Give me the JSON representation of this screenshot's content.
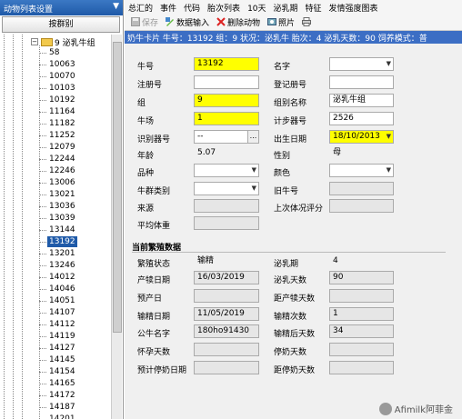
{
  "left_panel": {
    "title": "动物列表设置",
    "dropdown_arrow": "▼",
    "group_button": "按群别",
    "tree_root_label": "9 泌乳牛组",
    "tree_items": [
      "58",
      "10063",
      "10070",
      "10103",
      "10192",
      "11164",
      "11182",
      "11252",
      "12079",
      "12244",
      "12246",
      "13006",
      "13021",
      "13036",
      "13039",
      "13144",
      "13192",
      "13201",
      "13246",
      "14012",
      "14046",
      "14051",
      "14107",
      "14112",
      "14119",
      "14127",
      "14145",
      "14154",
      "14165",
      "14172",
      "14187",
      "14201"
    ],
    "selected_item": "13192"
  },
  "menu": [
    "总汇的",
    "事件",
    "代码",
    "胎次列表",
    "10天",
    "泌乳期",
    "特征",
    "发情强度图表"
  ],
  "toolbar": {
    "save_label": "保存",
    "data_input_label": "数据输入",
    "delete_animal_label": "删除动物",
    "photo_label": "照片"
  },
  "infobar_text": "奶牛卡片   牛号：13192   组：9   状况：泌乳牛   胎次：4   泌乳天数：90   饲养模式：普",
  "form": {
    "cow_no_label": "牛号",
    "cow_no": "13192",
    "name_label": "名字",
    "name": "",
    "reg_no_label": "注册号",
    "reg_no": "",
    "reg_cow_no_label": "登记册号",
    "reg_cow_no": "",
    "group_label": "组",
    "group": "9",
    "group_name_label": "组别名称",
    "group_name": "泌乳牛组",
    "farm_label": "牛场",
    "farm": "1",
    "pedometer_label": "计步器号",
    "pedometer": "2526",
    "id_device_label": "识别器号",
    "id_device": "--",
    "birth_date_label": "出生日期",
    "birth_date": "18/10/2013",
    "age_label": "年龄",
    "age": "5.07",
    "sex_label": "性别",
    "sex": "母",
    "breed_label": "品种",
    "breed": "",
    "color_label": "颜色",
    "color": "",
    "herd_type_label": "牛群类别",
    "herd_type": "",
    "old_cow_no_label": "旧牛号",
    "old_cow_no": "",
    "source_label": "来源",
    "source": "",
    "last_bcs_label": "上次体况评分",
    "last_bcs": "",
    "avg_weight_label": "平均体重",
    "avg_weight": ""
  },
  "breeding": {
    "section_title": "当前繁殖数据",
    "status_label": "繁殖状态",
    "status": "输精",
    "lact_label": "泌乳期",
    "lact": "4",
    "calving_date_label": "产犊日期",
    "calving_date": "16/03/2019",
    "dim_label": "泌乳天数",
    "dim": "90",
    "due_date_label": "预产日",
    "due_date": "",
    "days_to_calving_label": "距产犊天数",
    "days_to_calving": "",
    "insem_date_label": "输精日期",
    "insem_date": "11/05/2019",
    "insem_count_label": "输精次数",
    "insem_count": "1",
    "bull_name_label": "公牛名字",
    "bull_name": "180ho91430",
    "days_since_insem_label": "输精后天数",
    "days_since_insem": "34",
    "pregnant_days_label": "怀孕天数",
    "pregnant_days": "",
    "dry_days_label": "停奶天数",
    "dry_days": "",
    "expected_dry_date_label": "预计停奶日期",
    "expected_dry_date": "",
    "days_to_dry_label": "距停奶天数",
    "days_to_dry": ""
  },
  "watermark": "Afimilk阿菲金",
  "icons": [
    "save-icon",
    "data-input-icon",
    "delete-icon",
    "photo-icon",
    "print-icon"
  ]
}
